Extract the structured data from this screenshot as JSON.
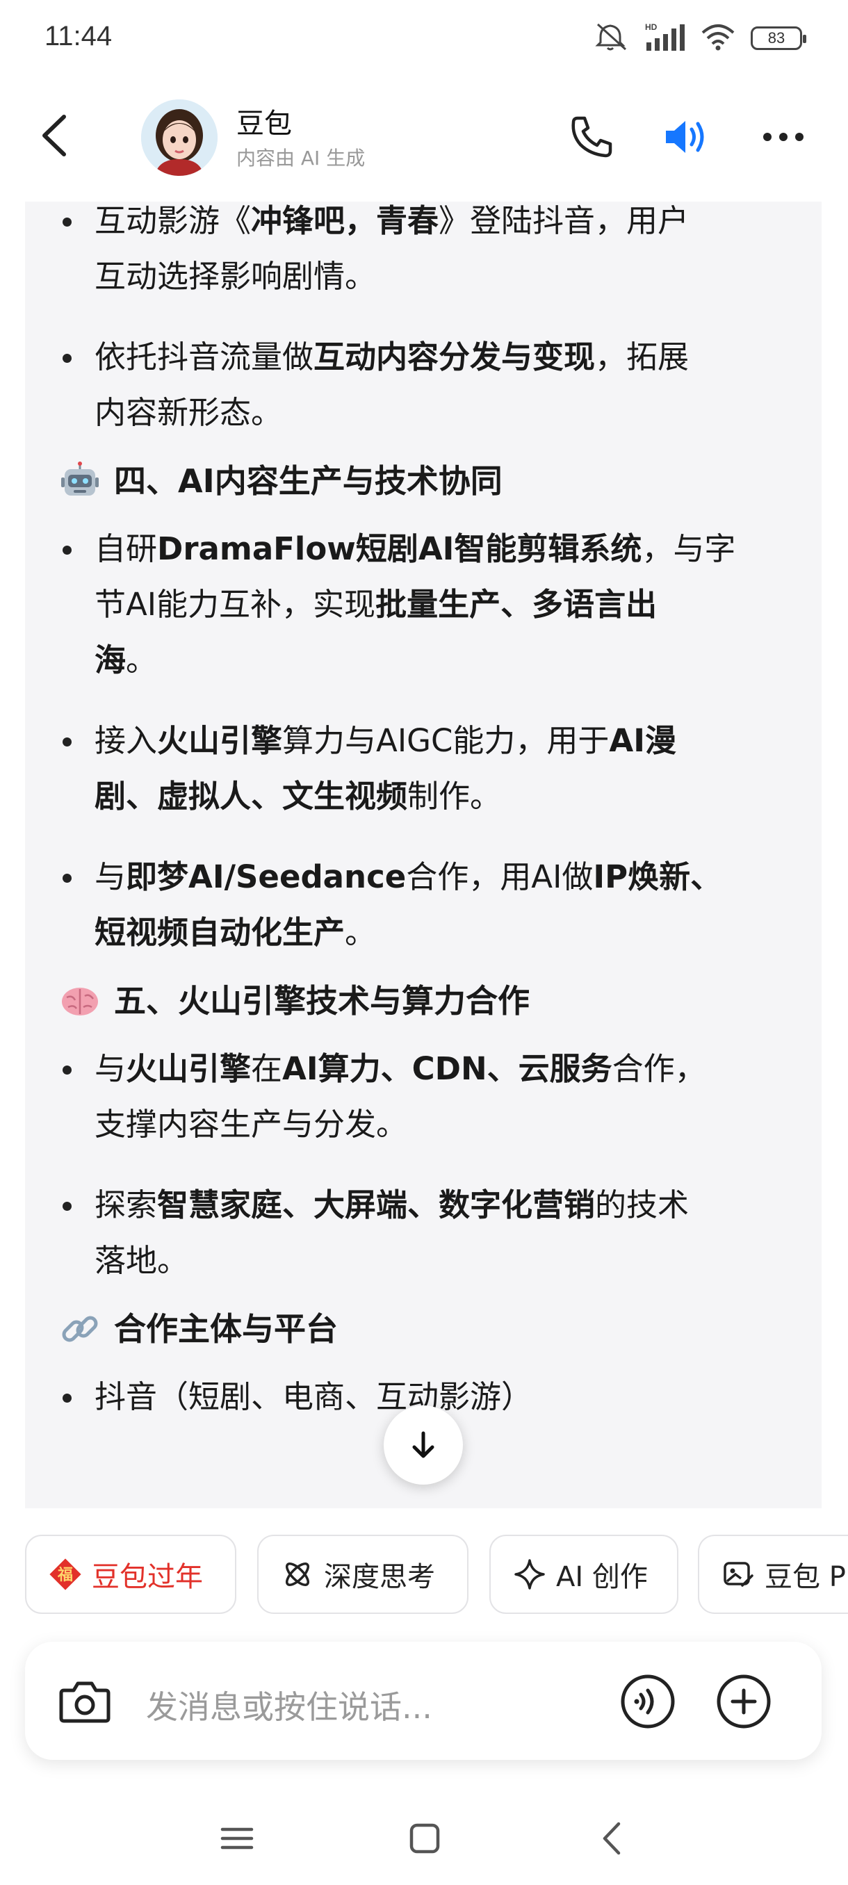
{
  "status_bar": {
    "time": "11:44",
    "battery": "83",
    "network": "HD"
  },
  "header": {
    "name": "豆包",
    "subtitle": "内容由 AI 生成"
  },
  "content": {
    "items": [
      {
        "type": "bullet",
        "parts": [
          {
            "t": "互动影游《",
            "b": false
          },
          {
            "t": "冲锋吧，青春",
            "b": true
          },
          {
            "t": "》登陆抖音，用户",
            "b": false
          }
        ],
        "cont": "互动选择影响剧情。"
      },
      {
        "type": "bullet",
        "parts": [
          {
            "t": "依托抖音流量做",
            "b": false
          },
          {
            "t": "互动内容分发与变现",
            "b": true
          },
          {
            "t": "，拓展",
            "b": false
          }
        ],
        "cont": "内容新形态。"
      },
      {
        "type": "section",
        "emoji": "robot",
        "title": "四、AI内容生产与技术协同"
      },
      {
        "type": "bullet3",
        "l1": [
          {
            "t": "自研",
            "b": false
          },
          {
            "t": "DramaFlow短剧AI智能剪辑系统",
            "b": true
          },
          {
            "t": "，与字",
            "b": false
          }
        ],
        "l2": [
          {
            "t": "节AI能力互补，实现",
            "b": false
          },
          {
            "t": "批量生产、多语言出",
            "b": true
          }
        ],
        "l3": [
          {
            "t": "海",
            "b": true
          },
          {
            "t": "。",
            "b": false
          }
        ]
      },
      {
        "type": "bullet2",
        "l1": [
          {
            "t": "接入",
            "b": false
          },
          {
            "t": "火山引擎",
            "b": true
          },
          {
            "t": "算力与AIGC能力，用于",
            "b": false
          },
          {
            "t": "AI漫",
            "b": true
          }
        ],
        "l2": [
          {
            "t": "剧、虚拟人、文生视频",
            "b": true
          },
          {
            "t": "制作。",
            "b": false
          }
        ]
      },
      {
        "type": "bullet2",
        "l1": [
          {
            "t": "与",
            "b": false
          },
          {
            "t": "即梦AI/Seedance",
            "b": true
          },
          {
            "t": "合作，用AI做",
            "b": false
          },
          {
            "t": "IP焕新、",
            "b": true
          }
        ],
        "l2": [
          {
            "t": "短视频自动化生产",
            "b": true
          },
          {
            "t": "。",
            "b": false
          }
        ]
      },
      {
        "type": "section",
        "emoji": "brain",
        "title": "五、火山引擎技术与算力合作"
      },
      {
        "type": "bullet",
        "parts": [
          {
            "t": "与",
            "b": false
          },
          {
            "t": "火山引擎",
            "b": true
          },
          {
            "t": "在",
            "b": false
          },
          {
            "t": "AI算力、CDN、云服务",
            "b": true
          },
          {
            "t": "合作，",
            "b": false
          }
        ],
        "cont": "支撑内容生产与分发。"
      },
      {
        "type": "bullet",
        "parts": [
          {
            "t": "探索",
            "b": false
          },
          {
            "t": "智慧家庭、大屏端、数字化营销",
            "b": true
          },
          {
            "t": "的技术",
            "b": false
          }
        ],
        "cont": "落地。"
      },
      {
        "type": "section",
        "emoji": "link",
        "title": "合作主体与平台"
      },
      {
        "type": "single",
        "text": "抖音（短剧、电商、互动影游）"
      }
    ]
  },
  "chips": [
    {
      "label": "豆包过年",
      "icon": "fu-icon",
      "color": "#e2312a"
    },
    {
      "label": "深度思考",
      "icon": "atom-icon"
    },
    {
      "label": "AI 创作",
      "icon": "sparkle-icon"
    },
    {
      "label": "豆包 P",
      "icon": "image-edit-icon"
    }
  ],
  "input": {
    "placeholder": "发消息或按住说话..."
  },
  "colors": {
    "accent": "#1677ff",
    "fu_red": "#e2312a",
    "bubble_bg": "#f5f5f7"
  }
}
